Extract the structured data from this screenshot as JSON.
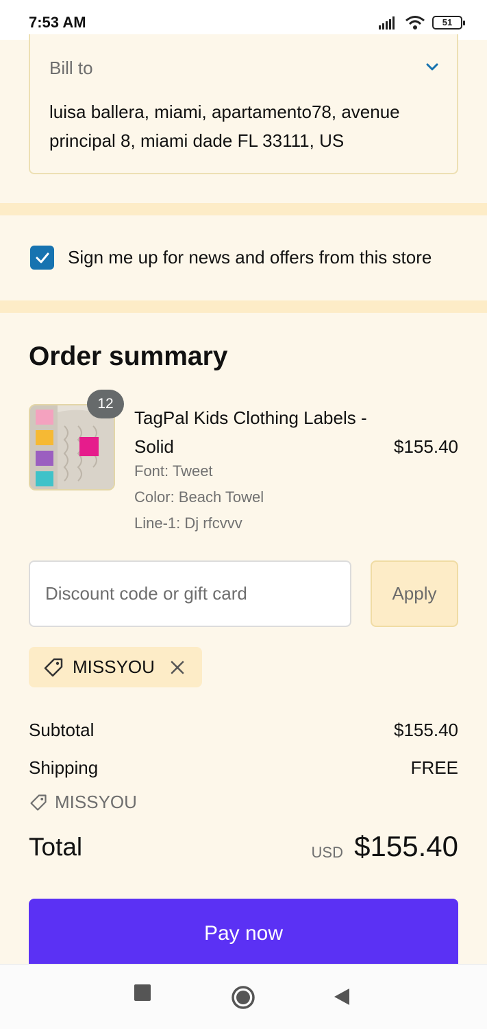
{
  "status_bar": {
    "time": "7:53 AM",
    "battery": "51"
  },
  "billing": {
    "label": "Bill to",
    "address": "luisa ballera, miami, apartamento78, avenue principal 8, miami dade FL 33111, US"
  },
  "newsletter": {
    "label": "Sign me up for news and offers from this store",
    "checked": true
  },
  "order_summary": {
    "title": "Order summary",
    "item": {
      "quantity": "12",
      "name": "TagPal Kids Clothing Labels - Solid",
      "price": "$155.40",
      "variants": [
        "Font: Tweet",
        "Color: Beach Towel",
        "Line-1: Dj rfcvvv"
      ]
    }
  },
  "discount": {
    "placeholder": "Discount code or gift card",
    "value": "",
    "apply_label": "Apply",
    "applied_code": "MISSYOU"
  },
  "totals": {
    "subtotal_label": "Subtotal",
    "subtotal_value": "$155.40",
    "shipping_label": "Shipping",
    "shipping_value": "FREE",
    "discount_code": "MISSYOU",
    "total_label": "Total",
    "currency": "USD",
    "total_value": "$155.40"
  },
  "pay_button": {
    "label": "Pay now"
  },
  "colors": {
    "accent": "#5b31f4",
    "checkbox": "#1773b0",
    "background": "#fdf7ea",
    "band": "#fdecc7"
  }
}
